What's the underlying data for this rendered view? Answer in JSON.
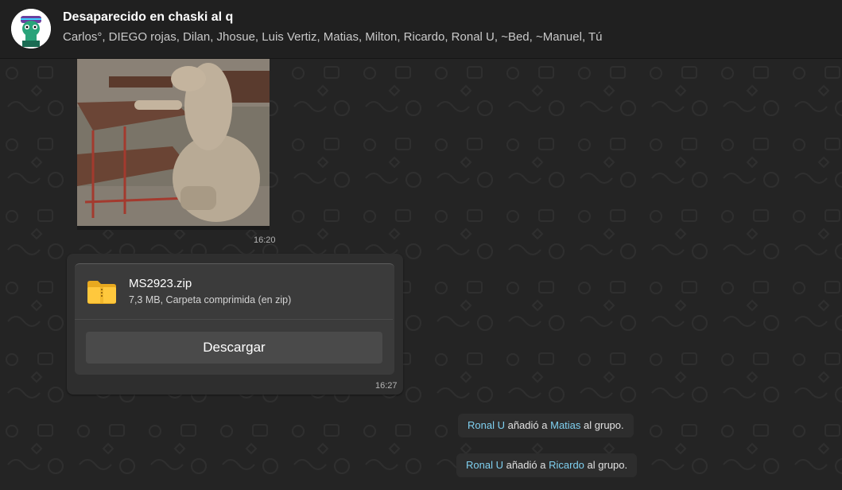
{
  "header": {
    "title": "Desaparecido en chaski al q",
    "members": "Carlos°, DIEGO rojas, Dilan, Jhosue, Luis Vertiz, Matias, Milton, Ricardo, Ronal U, ~Bed, ~Manuel, Tú",
    "avatar_icon": "group-avatar-icon"
  },
  "messages": {
    "image": {
      "time": "16:20"
    },
    "file": {
      "name": "MS2923.zip",
      "meta": "7,3 MB, Carpeta comprimida (en zip)",
      "download_label": "Descargar",
      "time": "16:27",
      "icon": "folder-zip-icon"
    },
    "system": [
      {
        "actor": "Ronal U",
        "verb": "añadió a",
        "target": "Matias",
        "suffix": "al grupo."
      },
      {
        "actor": "Ronal U",
        "verb": "añadió a",
        "target": "Ricardo",
        "suffix": "al grupo."
      }
    ]
  },
  "colors": {
    "accent_name": "#7fd0f0",
    "background": "#242424",
    "bubble": "#2e2e2e"
  }
}
